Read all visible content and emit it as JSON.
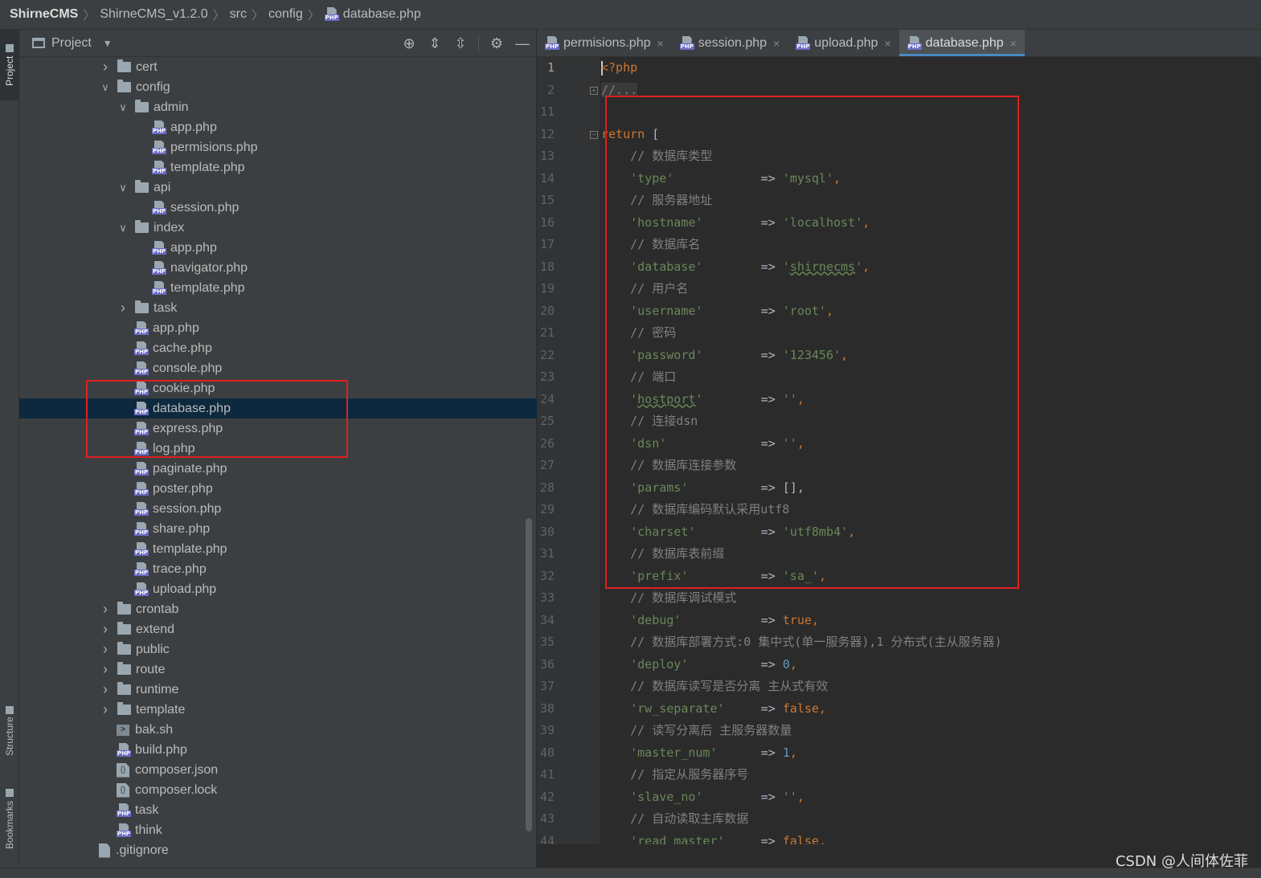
{
  "breadcrumb": [
    "ShirneCMS",
    "ShirneCMS_v1.2.0",
    "src",
    "config",
    "database.php"
  ],
  "stripe": {
    "project_label": "Project",
    "structure_label": "Structure",
    "bookmarks_label": "Bookmarks"
  },
  "project_panel": {
    "title": "Project",
    "tree": [
      {
        "label": "cert",
        "kind": "folder",
        "depth": 1,
        "expanded": false
      },
      {
        "label": "config",
        "kind": "folder",
        "depth": 1,
        "expanded": true
      },
      {
        "label": "admin",
        "kind": "folder",
        "depth": 2,
        "expanded": true
      },
      {
        "label": "app.php",
        "kind": "php",
        "depth": 3
      },
      {
        "label": "permisions.php",
        "kind": "php",
        "depth": 3
      },
      {
        "label": "template.php",
        "kind": "php",
        "depth": 3
      },
      {
        "label": "api",
        "kind": "folder",
        "depth": 2,
        "expanded": true
      },
      {
        "label": "session.php",
        "kind": "php",
        "depth": 3
      },
      {
        "label": "index",
        "kind": "folder",
        "depth": 2,
        "expanded": true
      },
      {
        "label": "app.php",
        "kind": "php",
        "depth": 3
      },
      {
        "label": "navigator.php",
        "kind": "php",
        "depth": 3
      },
      {
        "label": "template.php",
        "kind": "php",
        "depth": 3
      },
      {
        "label": "task",
        "kind": "folder",
        "depth": 2,
        "expanded": false
      },
      {
        "label": "app.php",
        "kind": "php",
        "depth": 2
      },
      {
        "label": "cache.php",
        "kind": "php",
        "depth": 2
      },
      {
        "label": "console.php",
        "kind": "php",
        "depth": 2
      },
      {
        "label": "cookie.php",
        "kind": "php",
        "depth": 2
      },
      {
        "label": "database.php",
        "kind": "php",
        "depth": 2,
        "selected": true
      },
      {
        "label": "express.php",
        "kind": "php",
        "depth": 2
      },
      {
        "label": "log.php",
        "kind": "php",
        "depth": 2
      },
      {
        "label": "paginate.php",
        "kind": "php",
        "depth": 2
      },
      {
        "label": "poster.php",
        "kind": "php",
        "depth": 2
      },
      {
        "label": "session.php",
        "kind": "php",
        "depth": 2
      },
      {
        "label": "share.php",
        "kind": "php",
        "depth": 2
      },
      {
        "label": "template.php",
        "kind": "php",
        "depth": 2
      },
      {
        "label": "trace.php",
        "kind": "php",
        "depth": 2
      },
      {
        "label": "upload.php",
        "kind": "php",
        "depth": 2
      },
      {
        "label": "crontab",
        "kind": "folder",
        "depth": 1,
        "expanded": false
      },
      {
        "label": "extend",
        "kind": "folder",
        "depth": 1,
        "expanded": false
      },
      {
        "label": "public",
        "kind": "folder",
        "depth": 1,
        "expanded": false
      },
      {
        "label": "route",
        "kind": "folder",
        "depth": 1,
        "expanded": false
      },
      {
        "label": "runtime",
        "kind": "folder",
        "depth": 1,
        "expanded": false
      },
      {
        "label": "template",
        "kind": "folder",
        "depth": 1,
        "expanded": false
      },
      {
        "label": "bak.sh",
        "kind": "sh",
        "depth": 1
      },
      {
        "label": "build.php",
        "kind": "php",
        "depth": 1
      },
      {
        "label": "composer.json",
        "kind": "json",
        "depth": 1
      },
      {
        "label": "composer.lock",
        "kind": "json",
        "depth": 1
      },
      {
        "label": "task",
        "kind": "php",
        "depth": 1
      },
      {
        "label": "think",
        "kind": "php",
        "depth": 1
      },
      {
        "label": ".gitignore",
        "kind": "git",
        "depth": 0
      }
    ]
  },
  "editor_tabs": [
    {
      "label": "permisions.php",
      "active": false
    },
    {
      "label": "session.php",
      "active": false
    },
    {
      "label": "upload.php",
      "active": false
    },
    {
      "label": "database.php",
      "active": true
    }
  ],
  "code_lines": [
    {
      "n": "1",
      "tokens": [
        [
          "kw",
          "<?php"
        ]
      ],
      "current": true
    },
    {
      "n": "2",
      "tokens": [
        [
          "fold",
          "//..."
        ]
      ],
      "fold": "+"
    },
    {
      "n": "11",
      "tokens": []
    },
    {
      "n": "12",
      "tokens": [
        [
          "kw",
          "return"
        ],
        [
          "op",
          " ["
        ]
      ],
      "fold": "-"
    },
    {
      "n": "13",
      "tokens": [
        [
          "cm",
          "    // 数据库类型"
        ]
      ]
    },
    {
      "n": "14",
      "tokens": [
        [
          "op",
          "    "
        ],
        [
          "str",
          "'type'"
        ],
        [
          "op",
          "            => "
        ],
        [
          "str",
          "'mysql'"
        ],
        [
          "kw",
          ","
        ]
      ]
    },
    {
      "n": "15",
      "tokens": [
        [
          "cm",
          "    // 服务器地址"
        ]
      ]
    },
    {
      "n": "16",
      "tokens": [
        [
          "op",
          "    "
        ],
        [
          "str",
          "'hostname'"
        ],
        [
          "op",
          "        => "
        ],
        [
          "str",
          "'localhost'"
        ],
        [
          "kw",
          ","
        ]
      ]
    },
    {
      "n": "17",
      "tokens": [
        [
          "cm",
          "    // 数据库名"
        ]
      ]
    },
    {
      "n": "18",
      "tokens": [
        [
          "op",
          "    "
        ],
        [
          "str",
          "'database'"
        ],
        [
          "op",
          "        => "
        ],
        [
          "str",
          "'"
        ],
        [
          "sq",
          "shirnecms"
        ],
        [
          "str",
          "'"
        ],
        [
          "kw",
          ","
        ]
      ]
    },
    {
      "n": "19",
      "tokens": [
        [
          "cm",
          "    // 用户名"
        ]
      ]
    },
    {
      "n": "20",
      "tokens": [
        [
          "op",
          "    "
        ],
        [
          "str",
          "'username'"
        ],
        [
          "op",
          "        => "
        ],
        [
          "str",
          "'root'"
        ],
        [
          "kw",
          ","
        ]
      ]
    },
    {
      "n": "21",
      "tokens": [
        [
          "cm",
          "    // 密码"
        ]
      ]
    },
    {
      "n": "22",
      "tokens": [
        [
          "op",
          "    "
        ],
        [
          "str",
          "'password'"
        ],
        [
          "op",
          "        => "
        ],
        [
          "str",
          "'123456'"
        ],
        [
          "kw",
          ","
        ]
      ]
    },
    {
      "n": "23",
      "tokens": [
        [
          "cm",
          "    // 端口"
        ]
      ]
    },
    {
      "n": "24",
      "tokens": [
        [
          "op",
          "    "
        ],
        [
          "str",
          "'"
        ],
        [
          "sq",
          "hostport"
        ],
        [
          "str",
          "'"
        ],
        [
          "op",
          "        => "
        ],
        [
          "str",
          "''"
        ],
        [
          "kw",
          ","
        ]
      ]
    },
    {
      "n": "25",
      "tokens": [
        [
          "cm",
          "    // 连接dsn"
        ]
      ]
    },
    {
      "n": "26",
      "tokens": [
        [
          "op",
          "    "
        ],
        [
          "str",
          "'dsn'"
        ],
        [
          "op",
          "             => "
        ],
        [
          "str",
          "''"
        ],
        [
          "kw",
          ","
        ]
      ]
    },
    {
      "n": "27",
      "tokens": [
        [
          "cm",
          "    // 数据库连接参数"
        ]
      ]
    },
    {
      "n": "28",
      "tokens": [
        [
          "op",
          "    "
        ],
        [
          "str",
          "'params'"
        ],
        [
          "op",
          "          => [],"
        ]
      ]
    },
    {
      "n": "29",
      "tokens": [
        [
          "cm",
          "    // 数据库编码默认采用utf8"
        ]
      ]
    },
    {
      "n": "30",
      "tokens": [
        [
          "op",
          "    "
        ],
        [
          "str",
          "'charset'"
        ],
        [
          "op",
          "         => "
        ],
        [
          "str",
          "'utf8mb4'"
        ],
        [
          "kw",
          ","
        ]
      ]
    },
    {
      "n": "31",
      "tokens": [
        [
          "cm",
          "    // 数据库表前缀"
        ]
      ]
    },
    {
      "n": "32",
      "tokens": [
        [
          "op",
          "    "
        ],
        [
          "str",
          "'prefix'"
        ],
        [
          "op",
          "          => "
        ],
        [
          "str",
          "'sa_'"
        ],
        [
          "kw",
          ","
        ]
      ]
    },
    {
      "n": "33",
      "tokens": [
        [
          "cm",
          "    // 数据库调试模式"
        ]
      ]
    },
    {
      "n": "34",
      "tokens": [
        [
          "op",
          "    "
        ],
        [
          "str",
          "'debug'"
        ],
        [
          "op",
          "           => "
        ],
        [
          "kw",
          "true,"
        ]
      ]
    },
    {
      "n": "35",
      "tokens": [
        [
          "cm",
          "    // 数据库部署方式:0 集中式(单一服务器),1 分布式(主从服务器)"
        ]
      ]
    },
    {
      "n": "36",
      "tokens": [
        [
          "op",
          "    "
        ],
        [
          "str",
          "'deploy'"
        ],
        [
          "op",
          "          => "
        ],
        [
          "num",
          "0"
        ],
        [
          "kw",
          ","
        ]
      ]
    },
    {
      "n": "37",
      "tokens": [
        [
          "cm",
          "    // 数据库读写是否分离 主从式有效"
        ]
      ]
    },
    {
      "n": "38",
      "tokens": [
        [
          "op",
          "    "
        ],
        [
          "str",
          "'rw_separate'"
        ],
        [
          "op",
          "     => "
        ],
        [
          "kw",
          "false,"
        ]
      ]
    },
    {
      "n": "39",
      "tokens": [
        [
          "cm",
          "    // 读写分离后 主服务器数量"
        ]
      ]
    },
    {
      "n": "40",
      "tokens": [
        [
          "op",
          "    "
        ],
        [
          "str",
          "'master_num'"
        ],
        [
          "op",
          "      => "
        ],
        [
          "num",
          "1"
        ],
        [
          "kw",
          ","
        ]
      ]
    },
    {
      "n": "41",
      "tokens": [
        [
          "cm",
          "    // 指定从服务器序号"
        ]
      ]
    },
    {
      "n": "42",
      "tokens": [
        [
          "op",
          "    "
        ],
        [
          "str",
          "'slave_no'"
        ],
        [
          "op",
          "        => "
        ],
        [
          "str",
          "''"
        ],
        [
          "kw",
          ","
        ]
      ]
    },
    {
      "n": "43",
      "tokens": [
        [
          "cm",
          "    // 自动读取主库数据"
        ]
      ]
    },
    {
      "n": "44",
      "tokens": [
        [
          "op",
          "    "
        ],
        [
          "str",
          "'read_master'"
        ],
        [
          "op",
          "     => "
        ],
        [
          "kw",
          "false,"
        ]
      ]
    }
  ],
  "watermark": "CSDN @人间体佐菲"
}
